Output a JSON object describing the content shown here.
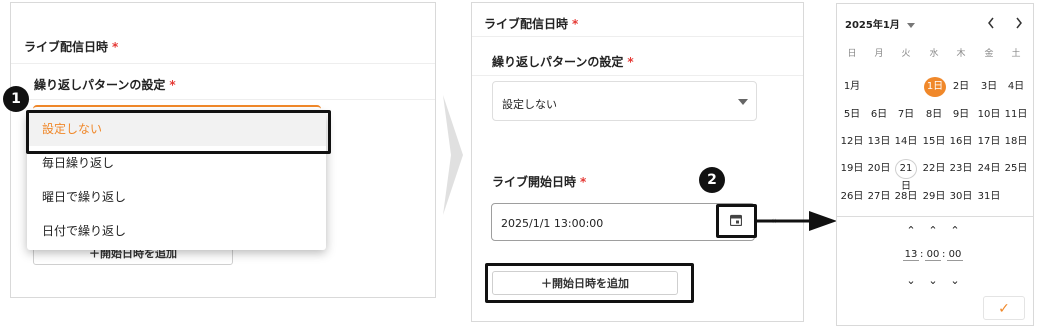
{
  "panel1": {
    "section_label": "ライブ配信日時",
    "required_mark": "*",
    "repeat_label": "繰り返しパターンの設定",
    "step_badge": "1",
    "dropdown_options": [
      "設定しない",
      "毎日繰り返し",
      "曜日で繰り返し",
      "日付で繰り返し"
    ],
    "selected_option": "設定しない",
    "add_button_label": "＋開始日時を追加"
  },
  "panel2": {
    "section_label": "ライブ配信日時",
    "required_mark": "*",
    "repeat_label": "繰り返しパターンの設定",
    "repeat_value": "設定しない",
    "start_label": "ライブ開始日時",
    "start_value": "2025/1/1 13:00:00",
    "step_badge": "2",
    "add_button_label": "＋開始日時を追加"
  },
  "calendar": {
    "month_label": "2025年1月",
    "weekdays": [
      "日",
      "月",
      "火",
      "水",
      "木",
      "金",
      "土"
    ],
    "month_marker": "1月",
    "days": [
      "1日",
      "2日",
      "3日",
      "4日",
      "5日",
      "6日",
      "7日",
      "8日",
      "9日",
      "10日",
      "11日",
      "12日",
      "13日",
      "14日",
      "15日",
      "16日",
      "17日",
      "18日",
      "19日",
      "20日",
      "21日",
      "22日",
      "23日",
      "24日",
      "25日",
      "26日",
      "27日",
      "28日",
      "29日",
      "30日",
      "31日"
    ],
    "first_weekday": 3,
    "selected_day": "1日",
    "today_day": "21日",
    "time": {
      "hour": "13",
      "minute": "00",
      "second": "00",
      "separator": ":"
    },
    "confirm_icon": "check-icon"
  },
  "colors": {
    "accent": "#f0882a",
    "required": "#e53935",
    "highlight_border": "#111111"
  }
}
